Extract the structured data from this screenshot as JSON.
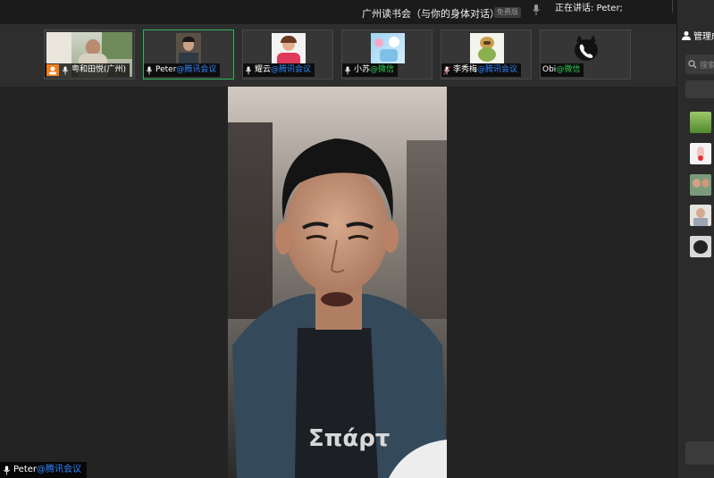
{
  "window": {
    "title": "广州读书会（与你的身体对话）",
    "badge": "免费版",
    "speaking": "正在讲话: Peter;"
  },
  "participants": [
    {
      "name": "粤和田悦(广州)",
      "source": "",
      "source_type": "none"
    },
    {
      "name": "Peter",
      "source": "@腾讯会议",
      "source_type": "tencent"
    },
    {
      "name": "耀云",
      "source": "@腾讯会议",
      "source_type": "tencent"
    },
    {
      "name": "小苏",
      "source": "@微信",
      "source_type": "wechat"
    },
    {
      "name": "李秀梅",
      "source": "@腾讯会议",
      "source_type": "tencent"
    },
    {
      "name": "Obi",
      "source": "@微信",
      "source_type": "wechat"
    }
  ],
  "main_speaker": {
    "name": "Peter",
    "source": "@腾讯会议"
  },
  "sidebar": {
    "header": "管理成",
    "search_placeholder": "搜索"
  },
  "colors": {
    "active_border": "#2fb25a",
    "tencent_blue": "#2f86ff",
    "wechat_green": "#2ecb52"
  }
}
